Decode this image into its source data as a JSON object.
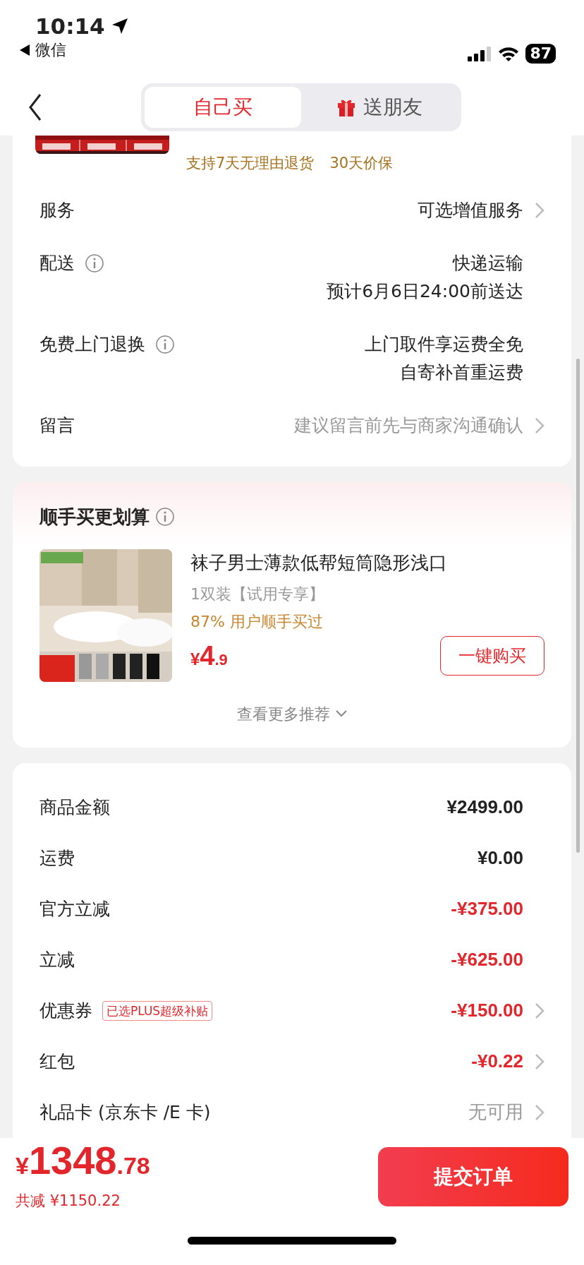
{
  "status_bar": {
    "time": "10:14",
    "back_app": "微信",
    "battery": "87"
  },
  "nav": {
    "tabs": [
      {
        "label": "自己买",
        "selected": true,
        "kind": "plain"
      },
      {
        "label": "送朋友",
        "selected": false,
        "kind": "gift"
      }
    ]
  },
  "order_card": {
    "guarantees": [
      "支持7天无理由退货",
      "30天价保"
    ],
    "rows": [
      {
        "label": "服务",
        "info": false,
        "values": [
          "可选增值服务"
        ],
        "kind": "default",
        "chevron": true
      },
      {
        "label": "配送",
        "info": true,
        "values": [
          "快递运输",
          "预计6月6日24:00前送达"
        ],
        "kind": "default",
        "chevron": false
      },
      {
        "label": "免费上门退换",
        "info": true,
        "values": [
          "上门取件享运费全免",
          "自寄补首重运费"
        ],
        "kind": "default",
        "chevron": false
      },
      {
        "label": "留言",
        "info": false,
        "values": [
          "建议留言前先与商家沟通确认"
        ],
        "kind": "muted",
        "chevron": true
      }
    ]
  },
  "recommend": {
    "title": "顺手买更划算",
    "info": true,
    "product": {
      "name": "袜子男士薄款低帮短筒隐形浅口",
      "spec": "1双装【试用专享】",
      "stat": "87% 用户顺手买过",
      "currency": "¥",
      "price_int": "4",
      "price_dec": ".9",
      "button": "一键购买"
    },
    "more": "查看更多推荐"
  },
  "summary": [
    {
      "label": "商品金额",
      "value": "¥2499.00",
      "kind": "default",
      "chevron": false
    },
    {
      "label": "运费",
      "value": "¥0.00",
      "kind": "default",
      "chevron": false
    },
    {
      "label": "官方立减",
      "value": "-¥375.00",
      "kind": "red",
      "chevron": false
    },
    {
      "label": "立减",
      "value": "-¥625.00",
      "kind": "red",
      "chevron": false
    },
    {
      "label": "优惠券",
      "tag": "已选PLUS超级补贴",
      "value": "-¥150.00",
      "kind": "red",
      "chevron": true
    },
    {
      "label": "红包",
      "value": "-¥0.22",
      "kind": "red",
      "chevron": true
    },
    {
      "label": "礼品卡 (京东卡 /E 卡)",
      "value": "无可用",
      "kind": "muted",
      "chevron": true
    }
  ],
  "footer": {
    "currency": "¥",
    "total_int": "1348",
    "total_dec": ".78",
    "saving": "共减 ¥1150.22",
    "button": "提交订单"
  }
}
